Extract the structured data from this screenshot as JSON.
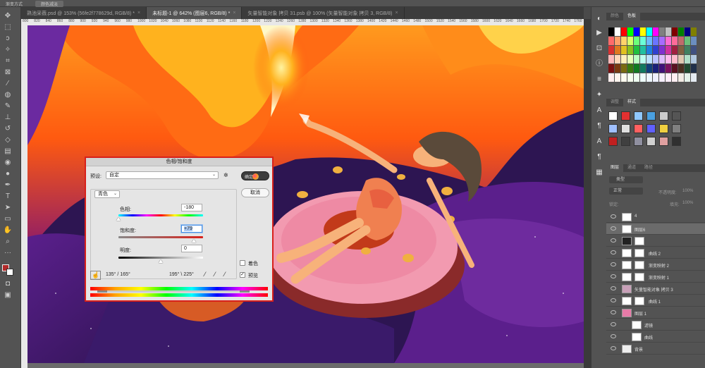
{
  "options_bar": {
    "left_text": "渐变方式",
    "mode_text": "颜色减淡"
  },
  "tabs": [
    {
      "label": "熟池采薇.psd @ 153% (56fe2f778629d, RGB/8) *",
      "active": false
    },
    {
      "label": "未标题-1 @ 642% (图层6, RGB/8) *",
      "active": true
    },
    {
      "label": "矢量智能对象 拷贝 31.psb @ 100% (矢量智能对象 拷贝 3, RGB/8)",
      "active": false
    }
  ],
  "ruler_labels": [
    "800",
    "820",
    "840",
    "860",
    "880",
    "900",
    "920",
    "940",
    "960",
    "980",
    "1000",
    "1020",
    "1040",
    "1060",
    "1080",
    "1100",
    "1120",
    "1140",
    "1160",
    "1180",
    "1200",
    "1220",
    "1240",
    "1260",
    "1280",
    "1300",
    "1320",
    "1340",
    "1360",
    "1380",
    "1400",
    "1420",
    "1440",
    "1460",
    "1480",
    "1500",
    "1520",
    "1540",
    "1560",
    "1580",
    "1600",
    "1620",
    "1640",
    "1660",
    "1680",
    "1700",
    "1720",
    "1740",
    "1760"
  ],
  "panels": {
    "swatch_tabs": [
      "颜色",
      "色板"
    ],
    "adjust_tabs": [
      "调整",
      "样式"
    ],
    "layer_tabs": [
      "图层",
      "通道",
      "路径"
    ],
    "layer_filter": "类型",
    "blend_mode": "正常",
    "opacity_label": "不透明度:",
    "opacity_value": "100%",
    "lock_label": "锁定:",
    "fill_label": "填充:",
    "fill_value": "100%"
  },
  "layers": [
    {
      "name": "4",
      "selected": false,
      "kind": "group"
    },
    {
      "name": "图层6",
      "selected": true,
      "kind": "layer"
    },
    {
      "name": "",
      "selected": false,
      "kind": "adjust-dark"
    },
    {
      "name": "曲线 2",
      "selected": false,
      "kind": "adjust"
    },
    {
      "name": "渐变映射 2",
      "selected": false,
      "kind": "adjust"
    },
    {
      "name": "渐变映射 1",
      "selected": false,
      "kind": "adjust"
    },
    {
      "name": "矢量智能对象 拷贝 3",
      "selected": false,
      "kind": "smart"
    },
    {
      "name": "曲线 1",
      "selected": false,
      "kind": "adjust"
    },
    {
      "name": "图层 1",
      "selected": false,
      "kind": "pink"
    },
    {
      "name": "滤镜",
      "selected": false,
      "kind": "sub"
    },
    {
      "name": "曲线",
      "selected": false,
      "kind": "sub"
    },
    {
      "name": "背景",
      "selected": false,
      "kind": "bg"
    }
  ],
  "dialog": {
    "title": "色相/饱和度",
    "preset_label": "预设:",
    "preset_value": "自定",
    "channel_value": "青色",
    "hue_label": "色相:",
    "hue_value": "-180",
    "sat_label": "饱和度:",
    "sat_value": "+79",
    "light_label": "明度:",
    "light_value": "0",
    "colorize_label": "着色",
    "preview_label": "预览",
    "ok_label": "确定",
    "cancel_label": "取消",
    "range_left": "135° / 165°",
    "range_right": "195° \\ 225°"
  },
  "colors": {
    "accent_red": "#d8201a",
    "canvas_bg": "#3b1c63"
  }
}
